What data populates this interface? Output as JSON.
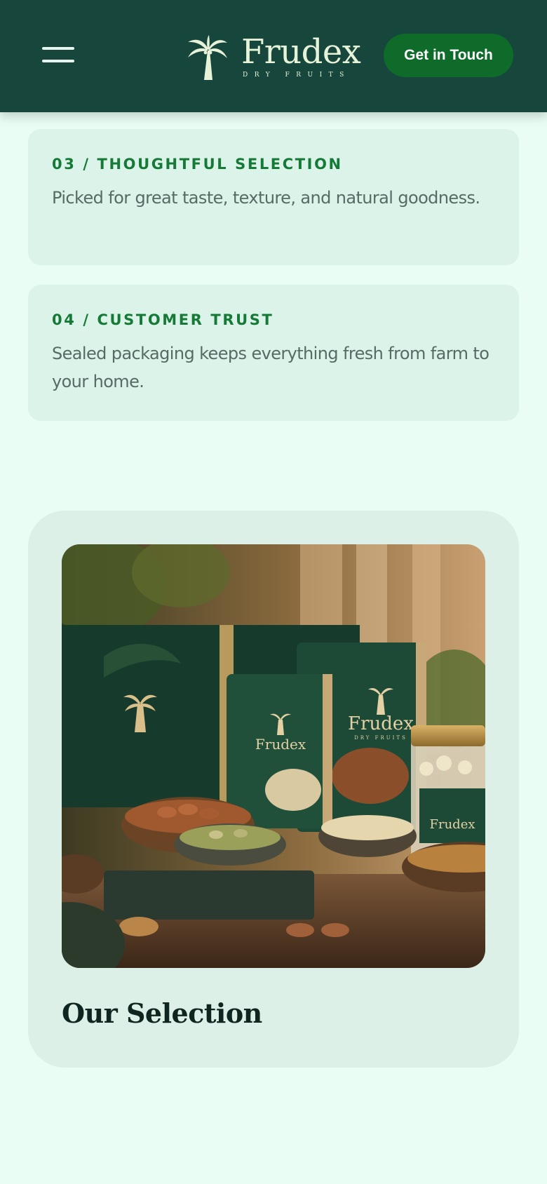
{
  "header": {
    "menu_icon": "hamburger-menu-icon",
    "logo": {
      "icon": "palm-tree-icon",
      "name": "Frudex",
      "tagline": "DRY FRUITS"
    },
    "cta_label": "Get in Touch"
  },
  "features": [
    {
      "title": "03 / THOUGHTFUL SELECTION",
      "text": "Picked for great taste, texture, and natural goodness."
    },
    {
      "title": "04 / CUSTOMER TRUST",
      "text": "Sealed packaging keeps everything fresh from farm to your home."
    }
  ],
  "selection": {
    "image_label": "Frudex",
    "image_sublabel": "DRY FRUITS",
    "heading": "Our Selection"
  },
  "colors": {
    "header_bg": "#17463c",
    "accent_green": "#157a35",
    "button_bg": "#0e6b2a",
    "page_bg": "#e9fdf4",
    "card_bg": "#dcf3ea"
  }
}
